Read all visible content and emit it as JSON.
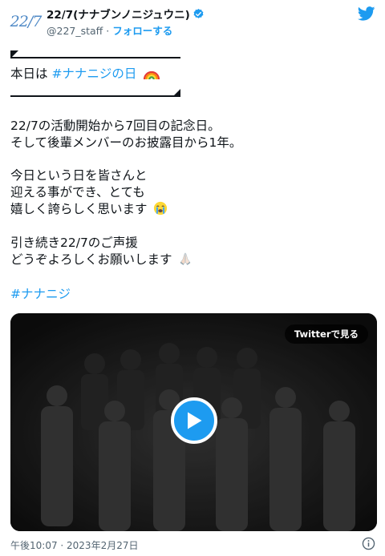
{
  "header": {
    "avatar_logo": "22/7",
    "display_name": "22/7(ナナブンノニジュウニ)",
    "handle": "@227_staff",
    "separator": " · ",
    "follow_label": "フォローする"
  },
  "tweet": {
    "line_day_prefix": "本日は ",
    "hashtag_day": "#ナナニジの日",
    "para1_line1": "22/7の活動開始から7回目の記念日。",
    "para1_line2": "そして後輩メンバーのお披露目から1年。",
    "para2_line1": "今日という日を皆さんと",
    "para2_line2": "迎える事ができ、とても",
    "para2_line3": "嬉しく誇らしく思います",
    "para3_line1": "引き続き22/7のご声援",
    "para3_line2": "どうぞよろしくお願いします",
    "hashtag_bottom": "#ナナニジ"
  },
  "video": {
    "watch_label": "Twitterで見る"
  },
  "footer": {
    "timestamp": "午後10:07 · 2023年2月27日"
  },
  "icons": {
    "brand": "twitter-bird-icon",
    "verified": "verified-badge-icon",
    "rainbow": "rainbow-emoji-icon",
    "crying": "loudly-crying-emoji-icon",
    "pray": "folded-hands-emoji-icon",
    "play": "play-icon",
    "info": "info-icon"
  },
  "colors": {
    "accent": "#1d9bf0",
    "text": "#0f1419",
    "muted": "#536471",
    "logo": "#4f89c6"
  }
}
